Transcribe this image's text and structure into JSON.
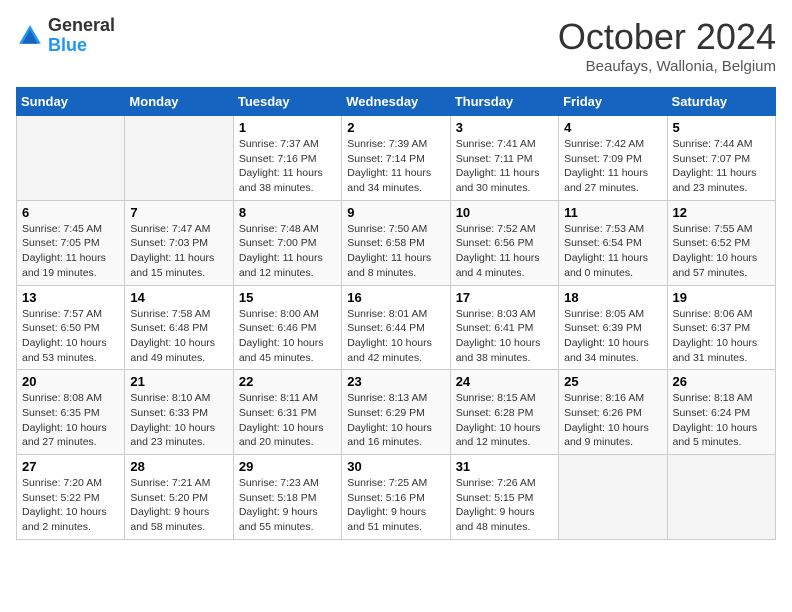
{
  "logo": {
    "line1": "General",
    "line2": "Blue"
  },
  "title": "October 2024",
  "location": "Beaufays, Wallonia, Belgium",
  "headers": [
    "Sunday",
    "Monday",
    "Tuesday",
    "Wednesday",
    "Thursday",
    "Friday",
    "Saturday"
  ],
  "weeks": [
    [
      {
        "day": "",
        "info": ""
      },
      {
        "day": "",
        "info": ""
      },
      {
        "day": "1",
        "info": "Sunrise: 7:37 AM\nSunset: 7:16 PM\nDaylight: 11 hours and 38 minutes."
      },
      {
        "day": "2",
        "info": "Sunrise: 7:39 AM\nSunset: 7:14 PM\nDaylight: 11 hours and 34 minutes."
      },
      {
        "day": "3",
        "info": "Sunrise: 7:41 AM\nSunset: 7:11 PM\nDaylight: 11 hours and 30 minutes."
      },
      {
        "day": "4",
        "info": "Sunrise: 7:42 AM\nSunset: 7:09 PM\nDaylight: 11 hours and 27 minutes."
      },
      {
        "day": "5",
        "info": "Sunrise: 7:44 AM\nSunset: 7:07 PM\nDaylight: 11 hours and 23 minutes."
      }
    ],
    [
      {
        "day": "6",
        "info": "Sunrise: 7:45 AM\nSunset: 7:05 PM\nDaylight: 11 hours and 19 minutes."
      },
      {
        "day": "7",
        "info": "Sunrise: 7:47 AM\nSunset: 7:03 PM\nDaylight: 11 hours and 15 minutes."
      },
      {
        "day": "8",
        "info": "Sunrise: 7:48 AM\nSunset: 7:00 PM\nDaylight: 11 hours and 12 minutes."
      },
      {
        "day": "9",
        "info": "Sunrise: 7:50 AM\nSunset: 6:58 PM\nDaylight: 11 hours and 8 minutes."
      },
      {
        "day": "10",
        "info": "Sunrise: 7:52 AM\nSunset: 6:56 PM\nDaylight: 11 hours and 4 minutes."
      },
      {
        "day": "11",
        "info": "Sunrise: 7:53 AM\nSunset: 6:54 PM\nDaylight: 11 hours and 0 minutes."
      },
      {
        "day": "12",
        "info": "Sunrise: 7:55 AM\nSunset: 6:52 PM\nDaylight: 10 hours and 57 minutes."
      }
    ],
    [
      {
        "day": "13",
        "info": "Sunrise: 7:57 AM\nSunset: 6:50 PM\nDaylight: 10 hours and 53 minutes."
      },
      {
        "day": "14",
        "info": "Sunrise: 7:58 AM\nSunset: 6:48 PM\nDaylight: 10 hours and 49 minutes."
      },
      {
        "day": "15",
        "info": "Sunrise: 8:00 AM\nSunset: 6:46 PM\nDaylight: 10 hours and 45 minutes."
      },
      {
        "day": "16",
        "info": "Sunrise: 8:01 AM\nSunset: 6:44 PM\nDaylight: 10 hours and 42 minutes."
      },
      {
        "day": "17",
        "info": "Sunrise: 8:03 AM\nSunset: 6:41 PM\nDaylight: 10 hours and 38 minutes."
      },
      {
        "day": "18",
        "info": "Sunrise: 8:05 AM\nSunset: 6:39 PM\nDaylight: 10 hours and 34 minutes."
      },
      {
        "day": "19",
        "info": "Sunrise: 8:06 AM\nSunset: 6:37 PM\nDaylight: 10 hours and 31 minutes."
      }
    ],
    [
      {
        "day": "20",
        "info": "Sunrise: 8:08 AM\nSunset: 6:35 PM\nDaylight: 10 hours and 27 minutes."
      },
      {
        "day": "21",
        "info": "Sunrise: 8:10 AM\nSunset: 6:33 PM\nDaylight: 10 hours and 23 minutes."
      },
      {
        "day": "22",
        "info": "Sunrise: 8:11 AM\nSunset: 6:31 PM\nDaylight: 10 hours and 20 minutes."
      },
      {
        "day": "23",
        "info": "Sunrise: 8:13 AM\nSunset: 6:29 PM\nDaylight: 10 hours and 16 minutes."
      },
      {
        "day": "24",
        "info": "Sunrise: 8:15 AM\nSunset: 6:28 PM\nDaylight: 10 hours and 12 minutes."
      },
      {
        "day": "25",
        "info": "Sunrise: 8:16 AM\nSunset: 6:26 PM\nDaylight: 10 hours and 9 minutes."
      },
      {
        "day": "26",
        "info": "Sunrise: 8:18 AM\nSunset: 6:24 PM\nDaylight: 10 hours and 5 minutes."
      }
    ],
    [
      {
        "day": "27",
        "info": "Sunrise: 7:20 AM\nSunset: 5:22 PM\nDaylight: 10 hours and 2 minutes."
      },
      {
        "day": "28",
        "info": "Sunrise: 7:21 AM\nSunset: 5:20 PM\nDaylight: 9 hours and 58 minutes."
      },
      {
        "day": "29",
        "info": "Sunrise: 7:23 AM\nSunset: 5:18 PM\nDaylight: 9 hours and 55 minutes."
      },
      {
        "day": "30",
        "info": "Sunrise: 7:25 AM\nSunset: 5:16 PM\nDaylight: 9 hours and 51 minutes."
      },
      {
        "day": "31",
        "info": "Sunrise: 7:26 AM\nSunset: 5:15 PM\nDaylight: 9 hours and 48 minutes."
      },
      {
        "day": "",
        "info": ""
      },
      {
        "day": "",
        "info": ""
      }
    ]
  ]
}
